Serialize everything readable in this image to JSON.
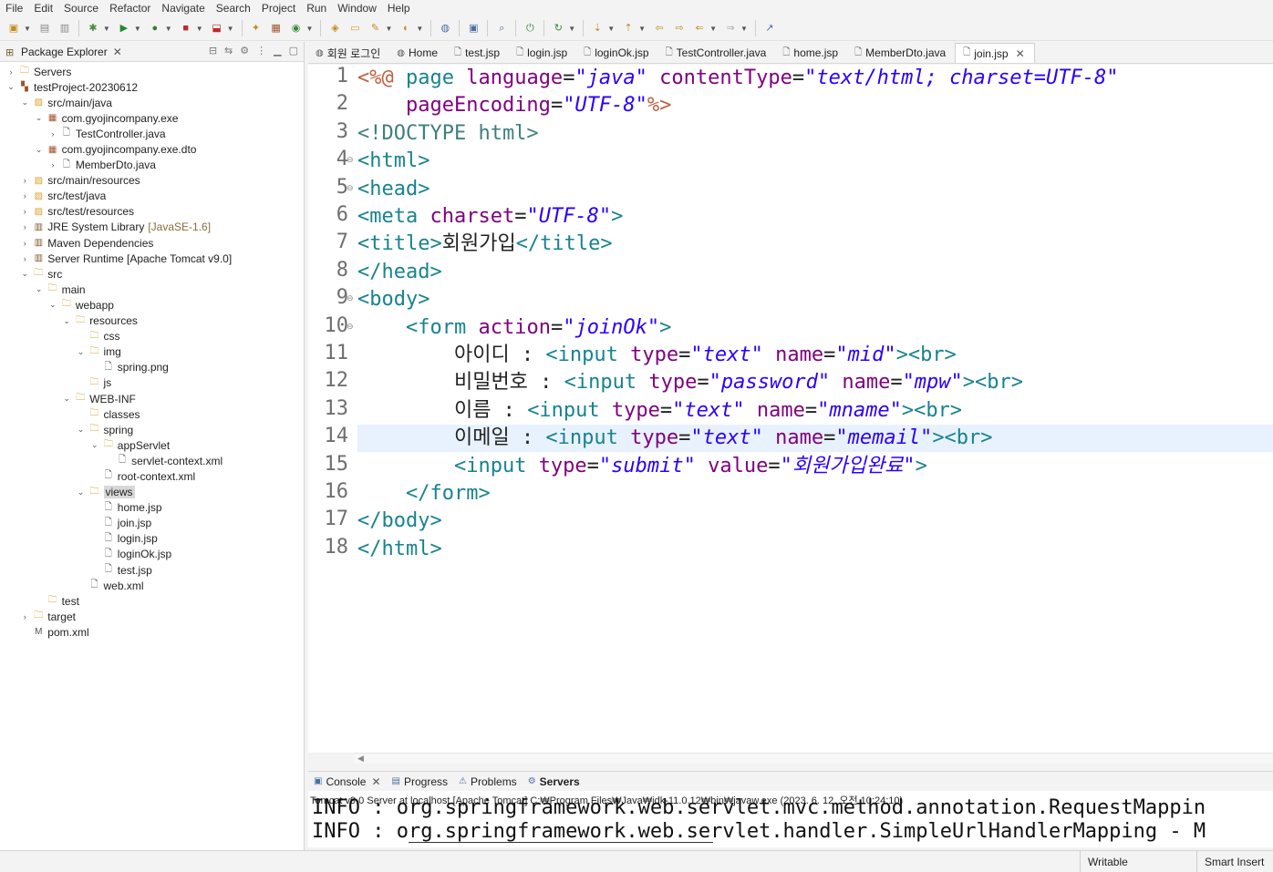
{
  "menu": [
    "File",
    "Edit",
    "Source",
    "Refactor",
    "Navigate",
    "Search",
    "Project",
    "Run",
    "Window",
    "Help"
  ],
  "explorer": {
    "title": "Package Explorer",
    "items": [
      {
        "label": "Servers",
        "icon": "folder",
        "twist": "›",
        "depth": 0
      },
      {
        "label": "testProject-20230612",
        "icon": "project",
        "twist": "⌄",
        "depth": 0
      },
      {
        "label": "src/main/java",
        "icon": "srcfolder",
        "twist": "⌄",
        "depth": 1
      },
      {
        "label": "com.gyojincompany.exe",
        "icon": "package",
        "twist": "⌄",
        "depth": 2
      },
      {
        "label": "TestController.java",
        "icon": "java",
        "twist": "›",
        "depth": 3
      },
      {
        "label": "com.gyojincompany.exe.dto",
        "icon": "package",
        "twist": "⌄",
        "depth": 2
      },
      {
        "label": "MemberDto.java",
        "icon": "java",
        "twist": "›",
        "depth": 3
      },
      {
        "label": "src/main/resources",
        "icon": "srcfolder",
        "twist": "›",
        "depth": 1
      },
      {
        "label": "src/test/java",
        "icon": "srcfolder",
        "twist": "›",
        "depth": 1
      },
      {
        "label": "src/test/resources",
        "icon": "srcfolder",
        "twist": "›",
        "depth": 1
      },
      {
        "label": "JRE System Library",
        "extra": "[JavaSE-1.6]",
        "icon": "library",
        "twist": "›",
        "depth": 1
      },
      {
        "label": "Maven Dependencies",
        "icon": "library",
        "twist": "›",
        "depth": 1
      },
      {
        "label": "Server Runtime [Apache Tomcat v9.0]",
        "icon": "library",
        "twist": "›",
        "depth": 1
      },
      {
        "label": "src",
        "icon": "folder",
        "twist": "⌄",
        "depth": 1
      },
      {
        "label": "main",
        "icon": "folder",
        "twist": "⌄",
        "depth": 2
      },
      {
        "label": "webapp",
        "icon": "folder",
        "twist": "⌄",
        "depth": 3
      },
      {
        "label": "resources",
        "icon": "folder",
        "twist": "⌄",
        "depth": 4
      },
      {
        "label": "css",
        "icon": "folder",
        "twist": "",
        "depth": 5
      },
      {
        "label": "img",
        "icon": "folder",
        "twist": "⌄",
        "depth": 5
      },
      {
        "label": "spring.png",
        "icon": "file",
        "twist": "",
        "depth": 6
      },
      {
        "label": "js",
        "icon": "folder",
        "twist": "",
        "depth": 5
      },
      {
        "label": "WEB-INF",
        "icon": "folder",
        "twist": "⌄",
        "depth": 4
      },
      {
        "label": "classes",
        "icon": "folder",
        "twist": "",
        "depth": 5
      },
      {
        "label": "spring",
        "icon": "folder",
        "twist": "⌄",
        "depth": 5
      },
      {
        "label": "appServlet",
        "icon": "folder",
        "twist": "⌄",
        "depth": 6
      },
      {
        "label": "servlet-context.xml",
        "icon": "xml",
        "twist": "",
        "depth": 7
      },
      {
        "label": "root-context.xml",
        "icon": "xml",
        "twist": "",
        "depth": 6
      },
      {
        "label": "views",
        "icon": "folder",
        "twist": "⌄",
        "depth": 5,
        "selected": true
      },
      {
        "label": "home.jsp",
        "icon": "file",
        "twist": "",
        "depth": 6
      },
      {
        "label": "join.jsp",
        "icon": "file",
        "twist": "",
        "depth": 6
      },
      {
        "label": "login.jsp",
        "icon": "file",
        "twist": "",
        "depth": 6
      },
      {
        "label": "loginOk.jsp",
        "icon": "file",
        "twist": "",
        "depth": 6
      },
      {
        "label": "test.jsp",
        "icon": "file",
        "twist": "",
        "depth": 6
      },
      {
        "label": "web.xml",
        "icon": "xml",
        "twist": "",
        "depth": 5
      },
      {
        "label": "test",
        "icon": "folder",
        "twist": "",
        "depth": 2
      },
      {
        "label": "target",
        "icon": "folder",
        "twist": "›",
        "depth": 1
      },
      {
        "label": "pom.xml",
        "icon": "maven",
        "twist": "",
        "depth": 1
      }
    ]
  },
  "tabs": [
    {
      "label": "회원 로그인",
      "icon": "globe-icon"
    },
    {
      "label": "Home",
      "icon": "globe-icon"
    },
    {
      "label": "test.jsp",
      "icon": "jsp-icon"
    },
    {
      "label": "login.jsp",
      "icon": "jsp-icon"
    },
    {
      "label": "loginOk.jsp",
      "icon": "jsp-icon"
    },
    {
      "label": "TestController.java",
      "icon": "java-icon"
    },
    {
      "label": "home.jsp",
      "icon": "jsp-icon"
    },
    {
      "label": "MemberDto.java",
      "icon": "java-icon"
    },
    {
      "label": "join.jsp",
      "icon": "jsp-icon",
      "active": true
    }
  ],
  "editor": {
    "current_line": 14,
    "lines": [
      {
        "n": "1",
        "fold": false,
        "tokens": [
          [
            "p",
            "<%@ "
          ],
          [
            "t",
            "page "
          ],
          [
            "a",
            "language"
          ],
          [
            "txt",
            "="
          ],
          [
            "s",
            "\"java\""
          ],
          [
            "txt",
            " "
          ],
          [
            "a",
            "contentType"
          ],
          [
            "txt",
            "="
          ],
          [
            "s",
            "\"text/html; charset=UTF-8\""
          ]
        ]
      },
      {
        "n": "2",
        "fold": false,
        "tokens": [
          [
            "txt",
            "    "
          ],
          [
            "a",
            "pageEncoding"
          ],
          [
            "txt",
            "="
          ],
          [
            "s",
            "\"UTF-8\""
          ],
          [
            "p",
            "%>"
          ]
        ]
      },
      {
        "n": "3",
        "fold": false,
        "tokens": [
          [
            "d",
            "<!DOCTYPE html>"
          ]
        ]
      },
      {
        "n": "4",
        "fold": true,
        "tokens": [
          [
            "t",
            "<html>"
          ]
        ]
      },
      {
        "n": "5",
        "fold": true,
        "tokens": [
          [
            "t",
            "<head>"
          ]
        ]
      },
      {
        "n": "6",
        "fold": false,
        "tokens": [
          [
            "t",
            "<meta "
          ],
          [
            "a",
            "charset"
          ],
          [
            "txt",
            "="
          ],
          [
            "s",
            "\"UTF-8\""
          ],
          [
            "t",
            ">"
          ]
        ]
      },
      {
        "n": "7",
        "fold": false,
        "tokens": [
          [
            "t",
            "<title>"
          ],
          [
            "txt",
            "회원가입"
          ],
          [
            "t",
            "</title>"
          ]
        ]
      },
      {
        "n": "8",
        "fold": false,
        "tokens": [
          [
            "t",
            "</head>"
          ]
        ]
      },
      {
        "n": "9",
        "fold": true,
        "tokens": [
          [
            "t",
            "<body>"
          ]
        ]
      },
      {
        "n": "10",
        "fold": true,
        "tokens": [
          [
            "txt",
            "    "
          ],
          [
            "t",
            "<form "
          ],
          [
            "a",
            "action"
          ],
          [
            "txt",
            "="
          ],
          [
            "s",
            "\"joinOk\""
          ],
          [
            "t",
            ">"
          ]
        ]
      },
      {
        "n": "11",
        "fold": false,
        "tokens": [
          [
            "txt",
            "        아이디 : "
          ],
          [
            "t",
            "<input "
          ],
          [
            "a",
            "type"
          ],
          [
            "txt",
            "="
          ],
          [
            "s",
            "\"text\""
          ],
          [
            "txt",
            " "
          ],
          [
            "a",
            "name"
          ],
          [
            "txt",
            "="
          ],
          [
            "s",
            "\"mid\""
          ],
          [
            "t",
            "><br>"
          ]
        ]
      },
      {
        "n": "12",
        "fold": false,
        "tokens": [
          [
            "txt",
            "        비밀번호 : "
          ],
          [
            "t",
            "<input "
          ],
          [
            "a",
            "type"
          ],
          [
            "txt",
            "="
          ],
          [
            "s",
            "\"password\""
          ],
          [
            "txt",
            " "
          ],
          [
            "a",
            "name"
          ],
          [
            "txt",
            "="
          ],
          [
            "s",
            "\"mpw\""
          ],
          [
            "t",
            "><br>"
          ]
        ]
      },
      {
        "n": "13",
        "fold": false,
        "tokens": [
          [
            "txt",
            "        이름 : "
          ],
          [
            "t",
            "<input "
          ],
          [
            "a",
            "type"
          ],
          [
            "txt",
            "="
          ],
          [
            "s",
            "\"text\""
          ],
          [
            "txt",
            " "
          ],
          [
            "a",
            "name"
          ],
          [
            "txt",
            "="
          ],
          [
            "s",
            "\"mname\""
          ],
          [
            "t",
            "><br>"
          ]
        ]
      },
      {
        "n": "14",
        "fold": false,
        "tokens": [
          [
            "txt",
            "        이메일 : "
          ],
          [
            "t",
            "<input "
          ],
          [
            "a",
            "type"
          ],
          [
            "txt",
            "="
          ],
          [
            "s",
            "\"text\""
          ],
          [
            "txt",
            " "
          ],
          [
            "a",
            "name"
          ],
          [
            "txt",
            "="
          ],
          [
            "s",
            "\"memail\""
          ],
          [
            "t",
            "><br>"
          ]
        ]
      },
      {
        "n": "15",
        "fold": false,
        "tokens": [
          [
            "txt",
            "        "
          ],
          [
            "t",
            "<input "
          ],
          [
            "a",
            "type"
          ],
          [
            "txt",
            "="
          ],
          [
            "s",
            "\"submit\""
          ],
          [
            "txt",
            " "
          ],
          [
            "a",
            "value"
          ],
          [
            "txt",
            "="
          ],
          [
            "s",
            "\"회원가입완료\""
          ],
          [
            "t",
            ">"
          ]
        ]
      },
      {
        "n": "16",
        "fold": false,
        "tokens": [
          [
            "txt",
            "    "
          ],
          [
            "t",
            "</form>"
          ]
        ]
      },
      {
        "n": "17",
        "fold": false,
        "tokens": [
          [
            "t",
            "</body>"
          ]
        ]
      },
      {
        "n": "18",
        "fold": false,
        "tokens": [
          [
            "t",
            "</html>"
          ]
        ]
      }
    ]
  },
  "bottom": {
    "tabs": [
      {
        "label": "Console",
        "closable": true,
        "bold": false
      },
      {
        "label": "Progress",
        "closable": false,
        "bold": false
      },
      {
        "label": "Problems",
        "closable": false,
        "bold": false
      },
      {
        "label": "Servers",
        "closable": false,
        "bold": true
      }
    ],
    "console_title": "Tomcat v9.0 Server at localhost [Apache Tomcat] C:₩Program Files₩Java₩jdk-11.0.12₩bin₩javaw.exe  (2023. 6. 12. 오전 10:24:10)",
    "log_lines": [
      "INFO : org.springframework.web.servlet.mvc.method.annotation.RequestMappin",
      "INFO : org.springframework.web.servlet.handler.SimpleUrlHandlerMapping - M"
    ]
  },
  "status": {
    "writable": "Writable",
    "insert_mode": "Smart Insert"
  }
}
